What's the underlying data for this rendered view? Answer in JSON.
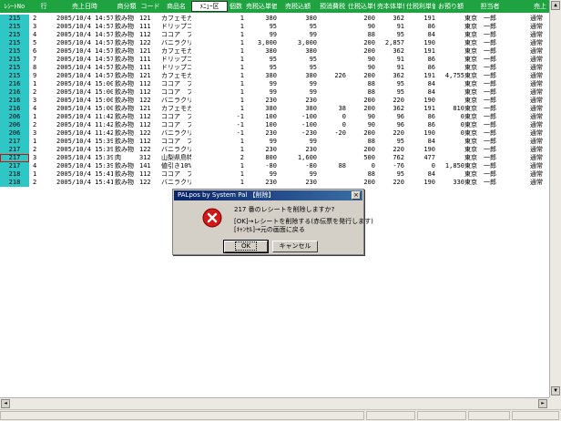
{
  "columns": [
    "ﾚｼｰﾄNo",
    "行",
    "売上日時",
    "商分類",
    "コード",
    "商品名",
    "ﾒﾆｭｰ区",
    "個数",
    "売税込単価",
    "売税込額",
    "預消費税",
    "仕税込単価",
    "売本体単価",
    "仕税利単価",
    "お預り額",
    "担当者",
    "売上"
  ],
  "rows": [
    [
      "215",
      "2",
      "2005/10/4 14:57",
      "飲み物",
      "121",
      "カフェモカ",
      "",
      "1",
      "380",
      "380",
      "",
      "200",
      "362",
      "191",
      "",
      "東京　一郎",
      "通常"
    ],
    [
      "215",
      "3",
      "2005/10/4 14:57",
      "飲み物",
      "111",
      "ドリップコーヒー",
      "",
      "1",
      "95",
      "95",
      "",
      "90",
      "91",
      "86",
      "",
      "東京　一郎",
      "通常"
    ],
    [
      "215",
      "4",
      "2005/10/4 14:57",
      "飲み物",
      "112",
      "ココア　フレーバーL",
      "",
      "1",
      "99",
      "99",
      "",
      "88",
      "95",
      "84",
      "",
      "東京　一郎",
      "通常"
    ],
    [
      "215",
      "5",
      "2005/10/4 14:57",
      "飲み物",
      "122",
      "バニラクリーム フローズーノ",
      "",
      "1",
      "3,000",
      "3,000",
      "",
      "200",
      "2,857",
      "190",
      "",
      "東京　一郎",
      "通常"
    ],
    [
      "215",
      "6",
      "2005/10/4 14:57",
      "飲み物",
      "121",
      "カフェモカ",
      "",
      "1",
      "380",
      "380",
      "",
      "200",
      "362",
      "191",
      "",
      "東京　一郎",
      "通常"
    ],
    [
      "215",
      "7",
      "2005/10/4 14:57",
      "飲み物",
      "111",
      "ドリップコーヒー",
      "",
      "1",
      "95",
      "95",
      "",
      "90",
      "91",
      "86",
      "",
      "東京　一郎",
      "通常"
    ],
    [
      "215",
      "8",
      "2005/10/4 14:57",
      "飲み物",
      "111",
      "ドリップコーヒー",
      "",
      "1",
      "95",
      "95",
      "",
      "90",
      "91",
      "86",
      "",
      "東京　一郎",
      "通常"
    ],
    [
      "215",
      "9",
      "2005/10/4 14:57",
      "飲み物",
      "121",
      "カフェモカ",
      "",
      "1",
      "380",
      "380",
      "226",
      "200",
      "362",
      "191",
      "4,755",
      "東京　一郎",
      "通常"
    ],
    [
      "216",
      "1",
      "2005/10/4 15:00",
      "飲み物",
      "112",
      "ココア　フレーバーL",
      "",
      "1",
      "99",
      "99",
      "",
      "88",
      "95",
      "84",
      "",
      "東京　一郎",
      "通常"
    ],
    [
      "216",
      "2",
      "2005/10/4 15:00",
      "飲み物",
      "112",
      "ココア　フレーバーL",
      "",
      "1",
      "99",
      "99",
      "",
      "88",
      "95",
      "84",
      "",
      "東京　一郎",
      "通常"
    ],
    [
      "216",
      "3",
      "2005/10/4 15:00",
      "飲み物",
      "122",
      "バニラクリーム フローズーノ",
      "",
      "1",
      "230",
      "230",
      "",
      "200",
      "220",
      "190",
      "",
      "東京　一郎",
      "通常"
    ],
    [
      "216",
      "4",
      "2005/10/4 15:00",
      "飲み物",
      "121",
      "カフェモカ",
      "",
      "1",
      "380",
      "380",
      "38",
      "200",
      "362",
      "191",
      "810",
      "東京　一郎",
      "通常"
    ],
    [
      "206",
      "1",
      "2005/10/4 11:42",
      "飲み物",
      "112",
      "ココア　フレーバーL",
      "",
      "-1",
      "100",
      "-100",
      "0",
      "90",
      "96",
      "86",
      "0",
      "東京　一郎",
      "通常"
    ],
    [
      "206",
      "2",
      "2005/10/4 11:42",
      "飲み物",
      "112",
      "ココア　フレーバーL",
      "",
      "-1",
      "100",
      "-100",
      "0",
      "90",
      "96",
      "86",
      "0",
      "東京　一郎",
      "通常"
    ],
    [
      "206",
      "3",
      "2005/10/4 11:42",
      "飲み物",
      "122",
      "バニラクリーム フローズーノ",
      "",
      "-1",
      "230",
      "-230",
      "-20",
      "200",
      "220",
      "190",
      "0",
      "東京　一郎",
      "通常"
    ],
    [
      "217",
      "1",
      "2005/10/4 15:39",
      "飲み物",
      "112",
      "ココア　フレーバーL",
      "",
      "1",
      "99",
      "99",
      "",
      "88",
      "95",
      "84",
      "",
      "東京　一郎",
      "通常"
    ],
    [
      "217",
      "2",
      "2005/10/4 15:39",
      "飲み物",
      "122",
      "バニラクリーム フローズーノ",
      "",
      "1",
      "230",
      "230",
      "",
      "200",
      "220",
      "190",
      "",
      "東京　一郎",
      "通常"
    ],
    [
      "217",
      "3",
      "2005/10/4 15:39",
      "肉",
      "312",
      "山梨県鳥特産　黒豚",
      "",
      "2",
      "800",
      "1,600",
      "",
      "500",
      "762",
      "477",
      "",
      "東京　一郎",
      "通常"
    ],
    [
      "217",
      "4",
      "2005/10/4 15:39",
      "飲み物",
      "141",
      "値引き10%",
      "",
      "1",
      "-80",
      "-80",
      "88",
      "0",
      "-76",
      "0",
      "1,850",
      "東京　一郎",
      "通常"
    ],
    [
      "218",
      "1",
      "2005/10/4 15:41",
      "飲み物",
      "112",
      "ココア　フレ",
      "",
      "1",
      "99",
      "99",
      "",
      "88",
      "95",
      "84",
      "",
      "東京　一郎",
      "通常"
    ],
    [
      "218",
      "2",
      "2005/10/4 15:41",
      "飲み物",
      "122",
      "バニラクリーム フローズーノ",
      "",
      "1",
      "230",
      "230",
      "",
      "200",
      "220",
      "190",
      "330",
      "東京　一郎",
      "通常"
    ]
  ],
  "dialog": {
    "title": "PALpos by System Pal 【削除】",
    "close_label": "×",
    "message_line1": "217 番のレシートを削除しますか?",
    "message_line2": "[OK]→レシートを削除する(赤伝票を発行します)",
    "message_line3": "[ｷｬﾝｾﾙ]→元の画面に戻る",
    "ok_label": "OK",
    "cancel_label": "キャンセル",
    "icon": "error-icon"
  },
  "scroll": {
    "up_icon": "▲",
    "down_icon": "▼",
    "left_icon": "◄",
    "right_icon": "►"
  },
  "colors": {
    "header_bg": "#1fa341",
    "receipt_col_bg": "#2fc6c6",
    "title_bar": "#0a246a",
    "error_red": "#d01818"
  }
}
